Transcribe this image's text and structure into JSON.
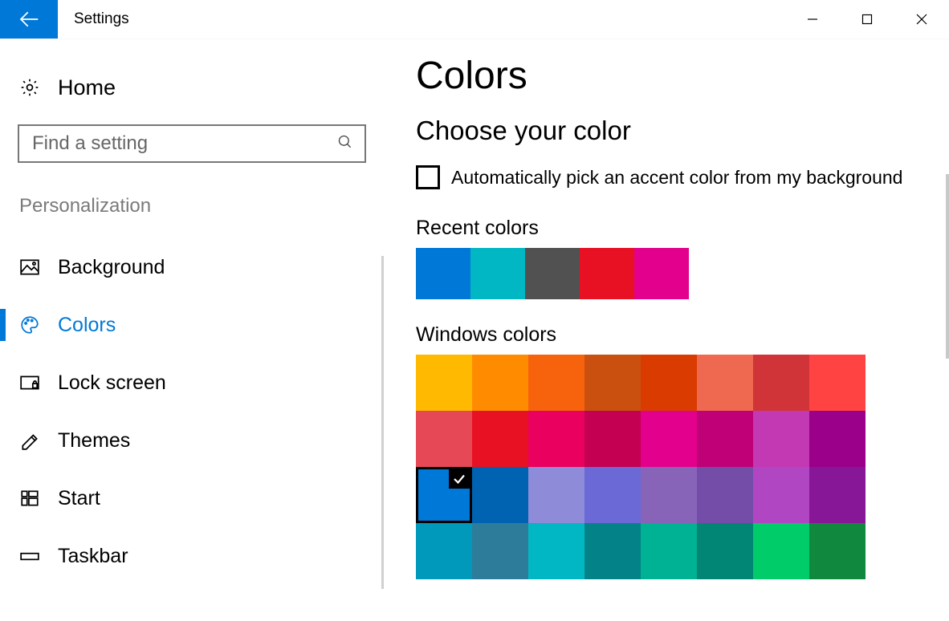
{
  "titlebar": {
    "title": "Settings"
  },
  "sidebar": {
    "home_label": "Home",
    "search_placeholder": "Find a setting",
    "category": "Personalization",
    "items": [
      {
        "icon": "picture-icon",
        "label": "Background",
        "active": false
      },
      {
        "icon": "palette-icon",
        "label": "Colors",
        "active": true
      },
      {
        "icon": "lock-icon",
        "label": "Lock screen",
        "active": false
      },
      {
        "icon": "themes-icon",
        "label": "Themes",
        "active": false
      },
      {
        "icon": "start-icon",
        "label": "Start",
        "active": false
      },
      {
        "icon": "taskbar-icon",
        "label": "Taskbar",
        "active": false
      }
    ]
  },
  "main": {
    "page_title": "Colors",
    "section_title": "Choose your color",
    "auto_pick_label": "Automatically pick an accent color from my background",
    "auto_pick_checked": false,
    "recent_label": "Recent colors",
    "recent_colors": [
      "#0078D7",
      "#00B7C3",
      "#515151",
      "#E81123",
      "#E3008C"
    ],
    "windows_label": "Windows colors",
    "windows_colors": [
      "#FFB900",
      "#FF8C00",
      "#F7630C",
      "#CA5010",
      "#DA3B01",
      "#EF6950",
      "#D13438",
      "#FF4343",
      "#E74856",
      "#E81123",
      "#EA005E",
      "#C30052",
      "#E3008C",
      "#BF0077",
      "#C239B3",
      "#9A0089",
      "#0078D7",
      "#0063B1",
      "#8E8CD8",
      "#6B69D6",
      "#8764B8",
      "#744DA9",
      "#B146C2",
      "#881798",
      "#0099BC",
      "#2D7D9A",
      "#00B7C3",
      "#038387",
      "#00B294",
      "#018574",
      "#00CC6A",
      "#10893E"
    ],
    "selected_color_index": 16
  }
}
